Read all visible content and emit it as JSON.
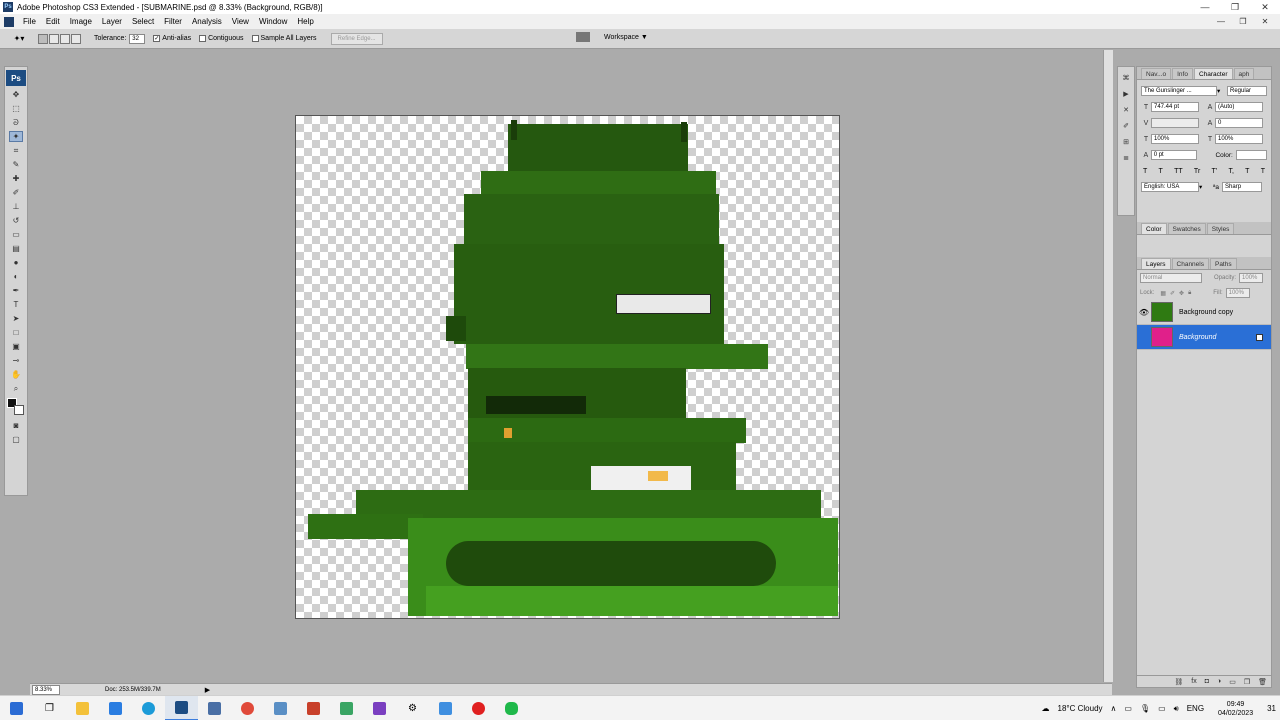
{
  "window": {
    "title": "Adobe Photoshop CS3 Extended - [SUBMARINE.psd @ 8.33% (Background, RGB/8)]",
    "app_icon_label": "Ps",
    "minimize_icon": "minimize-icon",
    "restore_icon": "restore-icon",
    "close_icon": "close-icon"
  },
  "menu": {
    "items": [
      "File",
      "Edit",
      "Image",
      "Layer",
      "Select",
      "Filter",
      "Analysis",
      "View",
      "Window",
      "Help"
    ]
  },
  "options": {
    "tolerance_label": "Tolerance:",
    "tolerance_value": "32",
    "anti_alias_label": "Anti-alias",
    "anti_alias_checked": "✓",
    "contiguous_label": "Contiguous",
    "sample_all_layers_label": "Sample All Layers",
    "refine_edge_label": "Refine Edge...",
    "workspace_label": "Workspace ▼"
  },
  "toolbox": {
    "logo": "Ps",
    "tools": [
      "move-tool",
      "marquee-tool",
      "lasso-tool",
      "magic-wand-tool",
      "crop-tool",
      "slice-tool",
      "healing-brush-tool",
      "brush-tool",
      "clone-stamp-tool",
      "history-brush-tool",
      "eraser-tool",
      "gradient-tool",
      "blur-tool",
      "dodge-tool",
      "pen-tool",
      "type-tool",
      "path-selection-tool",
      "shape-tool",
      "notes-tool",
      "eyedropper-tool",
      "hand-tool",
      "zoom-tool"
    ]
  },
  "status": {
    "zoom": "8.33%",
    "doc_info": "Doc: 253.5M/339.7M",
    "arrow": "▶"
  },
  "character_panel": {
    "tabs": [
      "Nav...o",
      "Info",
      "Character",
      "aph"
    ],
    "font_family": "The Gunslinger ...",
    "font_style": "Regular",
    "font_size": "747.44 pt",
    "leading": "(Auto)",
    "kerning": "",
    "tracking": "0",
    "vertical_scale": "100%",
    "horizontal_scale": "100%",
    "baseline_shift": "0 pt",
    "color_label": "Color:",
    "type_styles": [
      "T",
      "T",
      "TT",
      "Tr",
      "T'",
      "T,",
      "T",
      "T"
    ],
    "language": "English: USA",
    "aa_label": "ªa",
    "antialias": "Sharp"
  },
  "color_panel": {
    "tabs": [
      "Color",
      "Swatches",
      "Styles"
    ]
  },
  "layers_panel": {
    "tabs": [
      "Layers",
      "Channels",
      "Paths"
    ],
    "blend_mode": "Normal",
    "opacity_label": "Opacity:",
    "opacity_value": "100%",
    "lock_label": "Lock:",
    "fill_label": "Fill:",
    "fill_value": "100%",
    "layers": [
      {
        "name": "Background copy",
        "visible": true
      },
      {
        "name": "Background",
        "visible": false,
        "selected": true
      }
    ]
  },
  "taskbar": {
    "apps": [
      "start-icon",
      "task-view-icon",
      "file-explorer-icon",
      "store-icon",
      "edge-icon",
      "photoshop-icon",
      "calculator-icon",
      "chrome-icon",
      "app-icon-1",
      "app-icon-2",
      "app-icon-3",
      "visual-studio-icon",
      "settings-icon",
      "app-icon-4",
      "record-icon",
      "line-icon"
    ],
    "weather": "18°C  Cloudy",
    "tray_caret": "∧",
    "language": "ENG",
    "time": "09:49",
    "date": "04/02/2023",
    "notifications": "31"
  },
  "colors": {
    "accent": "#2a6fd6",
    "submarine_green": "#2f7a12",
    "photoshop_blue": "#1c4c82"
  }
}
